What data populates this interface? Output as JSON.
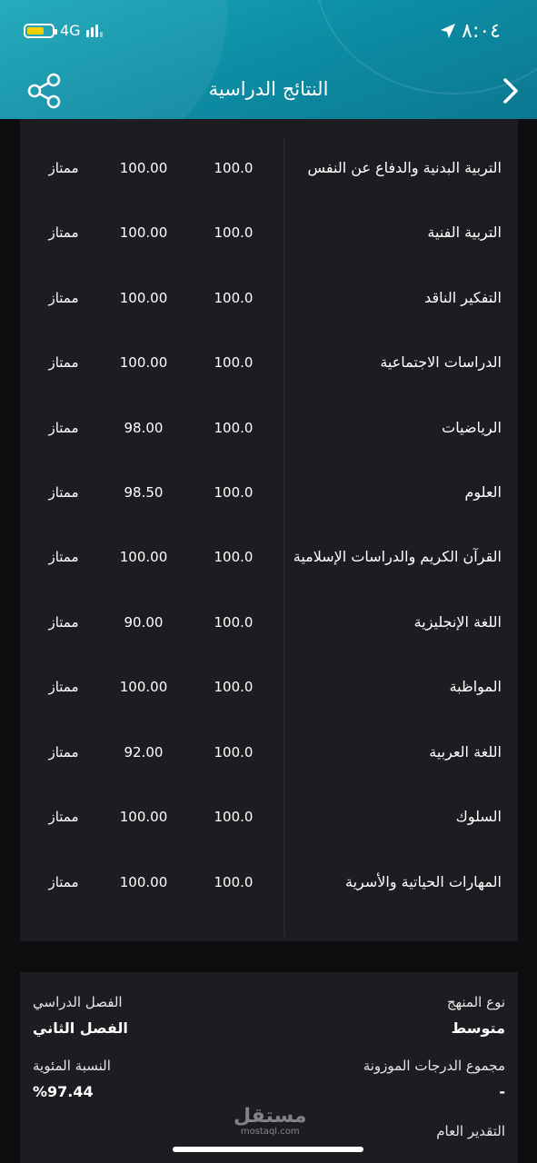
{
  "status_bar": {
    "time": "٨:٠٤",
    "network": "4G"
  },
  "header": {
    "title": "النتائج الدراسية"
  },
  "results": [
    {
      "subject": "التربية البدنية والدفاع عن النفس",
      "max": "100.0",
      "score": "100.00",
      "grade": "ممتاز"
    },
    {
      "subject": "التربية الفنية",
      "max": "100.0",
      "score": "100.00",
      "grade": "ممتاز"
    },
    {
      "subject": "التفكير الناقد",
      "max": "100.0",
      "score": "100.00",
      "grade": "ممتاز"
    },
    {
      "subject": "الدراسات الاجتماعية",
      "max": "100.0",
      "score": "100.00",
      "grade": "ممتاز"
    },
    {
      "subject": "الرياضيات",
      "max": "100.0",
      "score": "98.00",
      "grade": "ممتاز"
    },
    {
      "subject": "العلوم",
      "max": "100.0",
      "score": "98.50",
      "grade": "ممتاز"
    },
    {
      "subject": "القرآن الكريم والدراسات الإسلامية",
      "max": "100.0",
      "score": "100.00",
      "grade": "ممتاز"
    },
    {
      "subject": "اللغة الإنجليزية",
      "max": "100.0",
      "score": "90.00",
      "grade": "ممتاز"
    },
    {
      "subject": "المواظبة",
      "max": "100.0",
      "score": "100.00",
      "grade": "ممتاز"
    },
    {
      "subject": "اللغة العربية",
      "max": "100.0",
      "score": "92.00",
      "grade": "ممتاز"
    },
    {
      "subject": "السلوك",
      "max": "100.0",
      "score": "100.00",
      "grade": "ممتاز"
    },
    {
      "subject": "المهارات الحياتية والأسرية",
      "max": "100.0",
      "score": "100.00",
      "grade": "ممتاز"
    }
  ],
  "summary": {
    "curriculum_label": "نوع المنهج",
    "curriculum_value": "متوسط",
    "semester_label": "الفصل الدراسي",
    "semester_value": "الفصل الثاني",
    "weighted_total_label": "مجموع الدرجات الموزونة",
    "weighted_total_value": "-",
    "percentage_label": "النسبة المئوية",
    "percentage_value": "%97.44",
    "overall_grade_label": "التقدير العام"
  },
  "watermark": {
    "arabic": "مستقل",
    "latin": "mostaql.com"
  },
  "colors": {
    "header_teal": "#1596ad",
    "background": "#0d0e10",
    "card": "#1c1d21"
  }
}
